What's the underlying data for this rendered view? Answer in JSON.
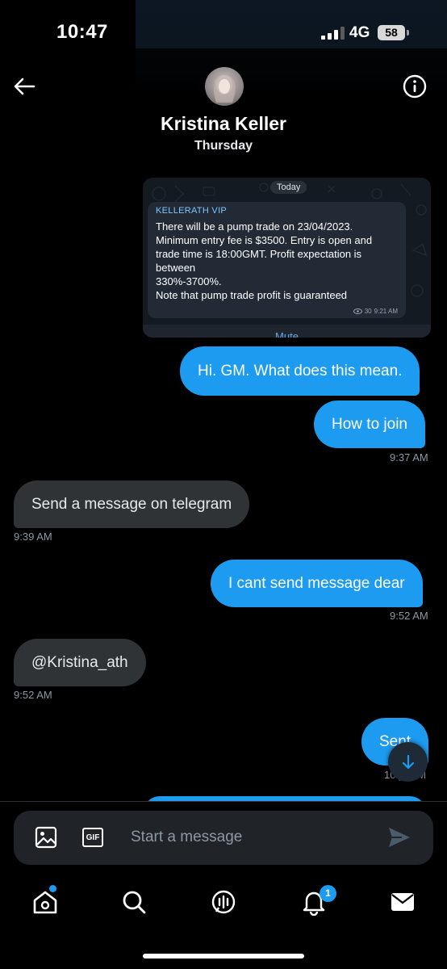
{
  "status_bar": {
    "time": "10:47",
    "network": "4G",
    "battery": "58"
  },
  "header": {
    "contact_name": "Kristina Keller",
    "back_icon": "back-arrow-icon",
    "info_icon": "info-icon"
  },
  "date_divider": "Thursday",
  "telegram_card": {
    "day_label": "Today",
    "sender": "KELLERATH VIP",
    "lines": [
      "There will be a pump trade on 23/04/2023.",
      "Minimum entry fee is $3500. Entry is open and",
      "trade time is 18:00GMT. Profit expectation is",
      "between",
      "330%-3700%.",
      "Note that pump trade profit is guaranteed"
    ],
    "views": "30",
    "time": "9:21 AM",
    "mute_label": "Mute"
  },
  "messages": [
    {
      "dir": "out",
      "text": "Hi. GM. What does this mean.",
      "time": ""
    },
    {
      "dir": "out",
      "text": "How to join",
      "time": "9:37 AM"
    },
    {
      "dir": "in",
      "text": "Send a message on telegram",
      "time": "9:39 AM"
    },
    {
      "dir": "out",
      "text": "I cant send message dear",
      "time": "9:52 AM"
    },
    {
      "dir": "in",
      "text": "@Kristina_ath",
      "time": "9:52 AM"
    },
    {
      "dir": "out",
      "text": "Sent",
      "time": "10:__AM"
    }
  ],
  "composer": {
    "placeholder": "Start a message",
    "gif_label": "GIF"
  },
  "nav": {
    "notifications_badge": "1",
    "items": [
      "home-icon",
      "search-icon",
      "spaces-icon",
      "notifications-icon",
      "messages-icon"
    ]
  },
  "colors": {
    "accent": "#1d9bf0",
    "incoming_bubble": "#2f3336",
    "background": "#000000"
  }
}
